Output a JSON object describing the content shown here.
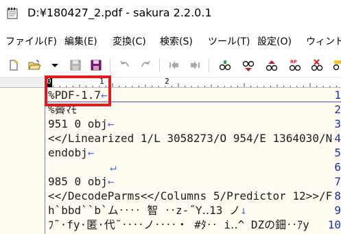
{
  "window": {
    "title": "D:¥180427_2.pdf - sakura 2.2.0.1"
  },
  "menubar": {
    "items": [
      {
        "label": "ファイル(F)"
      },
      {
        "label": "編集(E)"
      },
      {
        "label": "変換(C)"
      },
      {
        "label": "検索(S)"
      },
      {
        "label": "ツール(T)"
      },
      {
        "label": "設定(O)"
      },
      {
        "label": "ウィンド"
      }
    ]
  },
  "toolbar": {
    "buttons": [
      {
        "name": "new-file-icon"
      },
      {
        "name": "open-folder-icon"
      },
      {
        "name": "dropdown-arrow-icon"
      },
      {
        "name": "save-icon"
      },
      {
        "name": "save-all-icon"
      },
      {
        "name": "undo-icon"
      },
      {
        "name": "redo-icon"
      },
      {
        "name": "jump-back-icon"
      },
      {
        "name": "jump-forward-icon"
      },
      {
        "name": "search-glasses-icon"
      },
      {
        "name": "search-next-icon"
      },
      {
        "name": "search-prev-icon"
      },
      {
        "name": "replace-icon"
      },
      {
        "name": "clear-mark-icon"
      },
      {
        "name": "grep-icon"
      }
    ],
    "badges": {
      "replace": "RP"
    }
  },
  "ruler": {
    "cursor_col": "0",
    "marks": [
      "1",
      "2"
    ]
  },
  "editor": {
    "lines": [
      {
        "no": "1",
        "text": "%PDF-1.7",
        "eol": "←"
      },
      {
        "no": "2",
        "text": "%霽ﾏﾓ",
        "eol": ""
      },
      {
        "no": "3",
        "text": "951 0 obj",
        "eol": "←"
      },
      {
        "no": "4",
        "text": "<</Linearized 1/L 3058273/O 954/E 1364030/N",
        "eol": ""
      },
      {
        "no": "5",
        "text": "endobj",
        "eol": "←"
      },
      {
        "no": "6",
        "text": "",
        "eol": "↵"
      },
      {
        "no": "7",
        "text": "985 0 obj",
        "eol": "←"
      },
      {
        "no": "8",
        "text": "<</DecodeParms<</Columns 5/Predictor 12>>/F",
        "eol": ""
      },
      {
        "no": "9",
        "text": "h`bbd``b`ム‥‥ 智 ‥z-˝Y‥13 ノ",
        "eol": "↓"
      },
      {
        "no": "10",
        "text": "ﾌ˜·fy·匿·代˘‥‥ノ‥‥・ #ﾀ‥ i‥^ DZの鈿‥ｱy",
        "eol": ""
      }
    ]
  },
  "colors": {
    "editor_bg": "#fffbf0",
    "line_number": "#1b2fb5",
    "highlight_border": "#e3191b",
    "eol_mark": "#4a6fe8"
  }
}
